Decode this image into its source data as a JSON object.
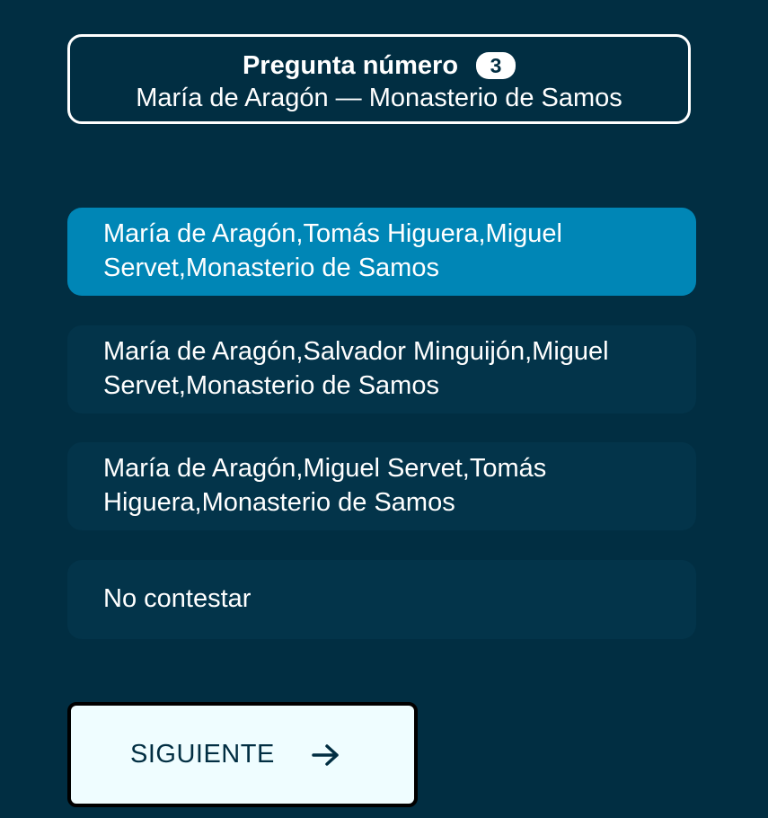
{
  "question": {
    "title": "Pregunta número",
    "number": "3",
    "subtitle": "María de Aragón — Monasterio de Samos"
  },
  "options": [
    {
      "label": "María de Aragón,Tomás Higuera,Miguel Servet,Monasterio de Samos",
      "selected": true
    },
    {
      "label": "María de Aragón,Salvador Minguijón,Miguel Servet,Monasterio de Samos",
      "selected": false
    },
    {
      "label": "María de Aragón,Miguel Servet,Tomás Higuera,Monasterio de Samos",
      "selected": false
    },
    {
      "label": "No contestar",
      "selected": false
    }
  ],
  "next_button": {
    "label": "SIGUIENTE",
    "icon": "arrow-right-icon"
  },
  "colors": {
    "background": "#012e42",
    "option_background": "#03344a",
    "selected_background": "#0086b6",
    "button_background": "#effdff"
  }
}
